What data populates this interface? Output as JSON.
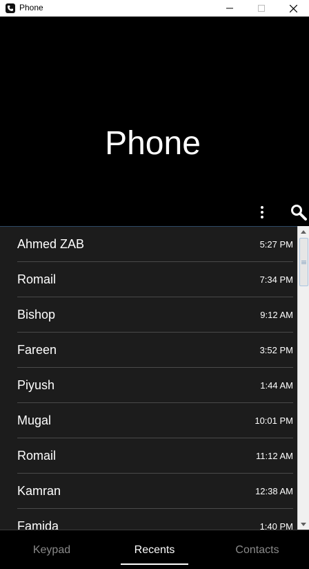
{
  "window": {
    "title": "Phone",
    "app_icon": "phone-icon",
    "controls": {
      "minimize": "minimize-icon",
      "maximize": "maximize-icon",
      "close": "close-icon"
    }
  },
  "header": {
    "title": "Phone",
    "more_icon": "more-vertical-icon",
    "search_icon": "search-icon"
  },
  "recents": [
    {
      "name": "Ahmed ZAB",
      "time": "5:27 PM"
    },
    {
      "name": "Romail",
      "time": "7:34 PM"
    },
    {
      "name": "Bishop",
      "time": "9:12 AM"
    },
    {
      "name": "Fareen",
      "time": "3:52 PM"
    },
    {
      "name": "Piyush",
      "time": "1:44 AM"
    },
    {
      "name": "Mugal",
      "time": "10:01 PM"
    },
    {
      "name": "Romail",
      "time": "11:12 AM"
    },
    {
      "name": "Kamran",
      "time": "12:38 AM"
    },
    {
      "name": "Famida",
      "time": "1:40 PM"
    }
  ],
  "tabs": [
    {
      "label": "Keypad",
      "active": false
    },
    {
      "label": "Recents",
      "active": true
    },
    {
      "label": "Contacts",
      "active": false
    }
  ],
  "colors": {
    "background": "#000000",
    "list_background": "#1c1c1c",
    "text": "#ffffff",
    "inactive_tab": "#8a8a8a"
  }
}
